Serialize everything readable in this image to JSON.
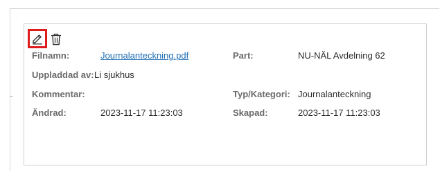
{
  "toolbar": {
    "edit_icon": "pencil-icon",
    "delete_icon": "trash-icon",
    "highlight_color": "#e01b1b"
  },
  "fields": {
    "filnamn_label": "Filnamn:",
    "filnamn_value": "Journalanteckning.pdf",
    "part_label": "Part:",
    "part_value": "NU-NÄL Avdelning 62",
    "uppladdad_label": "Uppladdad av:",
    "uppladdad_value": "Li sjukhus",
    "kommentar_label": "Kommentar:",
    "typ_label": "Typ/Kategori:",
    "typ_value": "Journalanteckning",
    "andrad_label": "Ändrad:",
    "andrad_value": "2023-11-17 11:23:03",
    "skapad_label": "Skapad:",
    "skapad_value": "2023-11-17 11:23:03"
  },
  "colors": {
    "link": "#1f6fb5",
    "label": "#6a6a6a",
    "border": "#cfcfcf"
  }
}
